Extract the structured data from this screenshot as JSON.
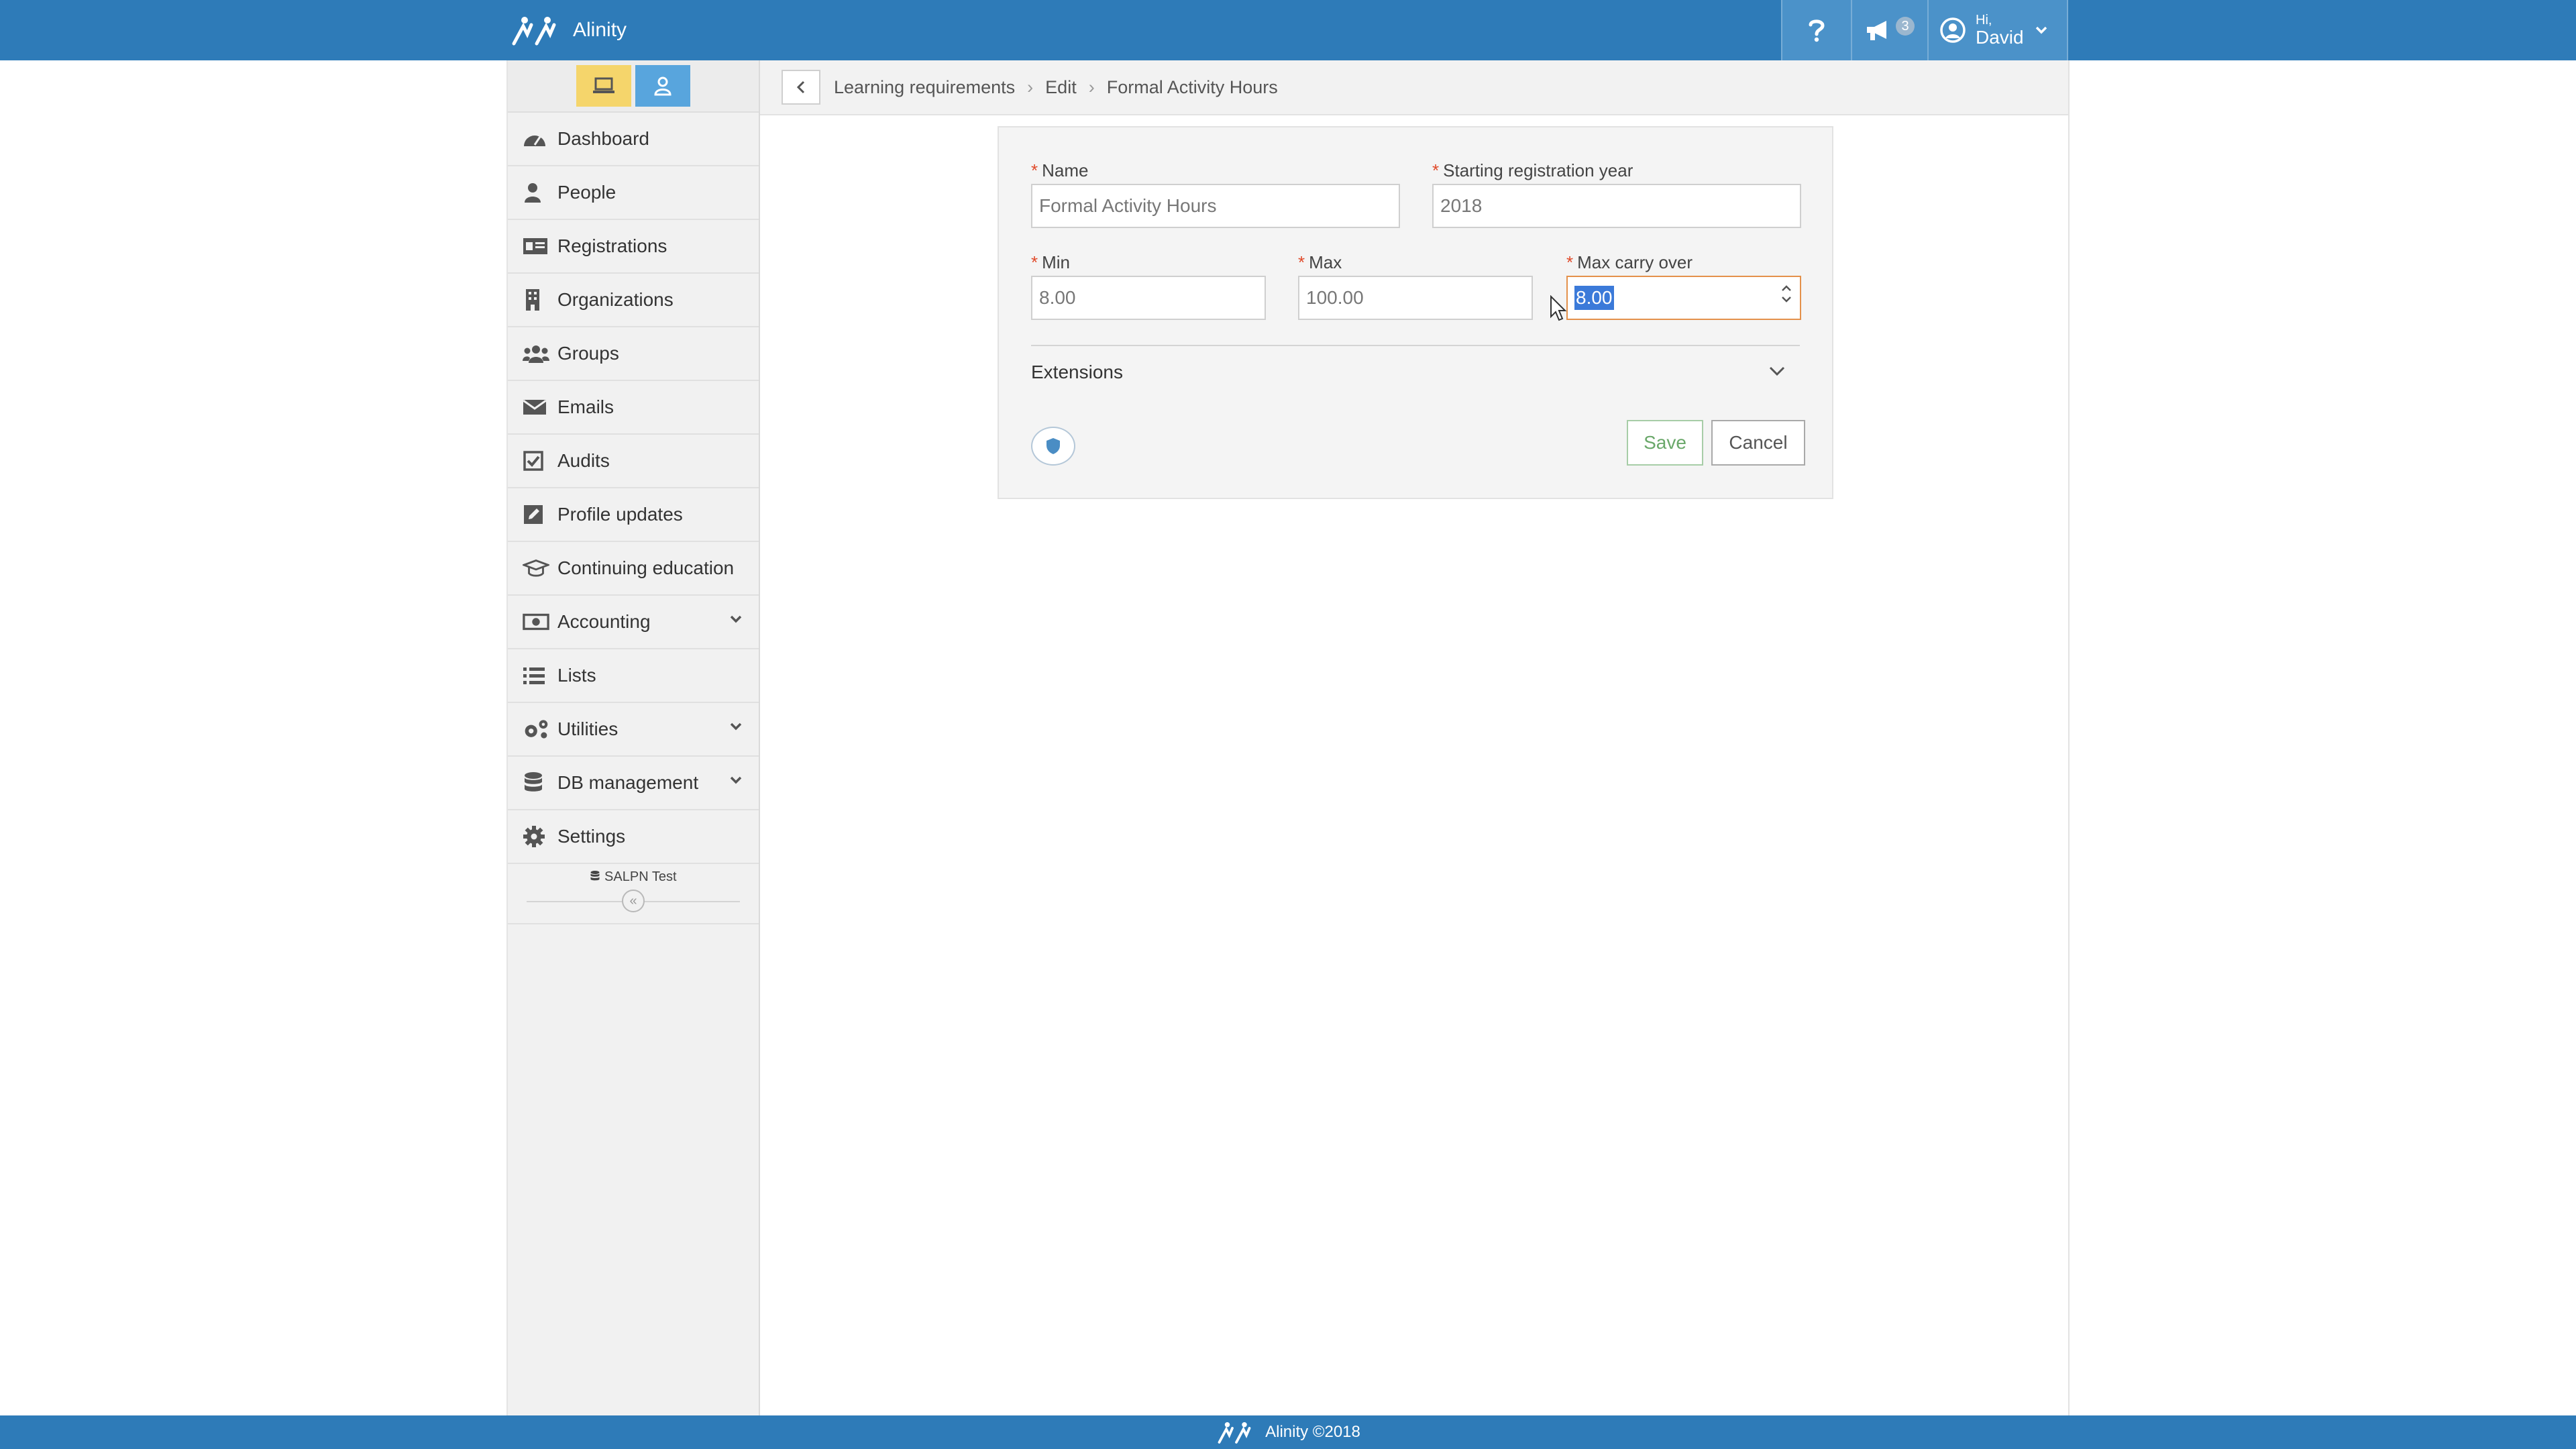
{
  "app": {
    "brand_name": "Alinity",
    "accent_color": "#2e7bb8"
  },
  "header": {
    "help_icon": "question-icon",
    "announcements": {
      "icon": "megaphone-icon",
      "count": "3"
    },
    "user": {
      "greeting": "Hi,",
      "name": "David",
      "icon": "user-circle-icon"
    }
  },
  "sidebar": {
    "toggles": [
      {
        "icon": "desktop-icon",
        "color": "#f5d56b"
      },
      {
        "icon": "person-icon",
        "color": "#58a5dd"
      }
    ],
    "items": [
      {
        "label": "Dashboard",
        "icon": "dashboard-icon"
      },
      {
        "label": "People",
        "icon": "person-icon"
      },
      {
        "label": "Registrations",
        "icon": "id-card-icon"
      },
      {
        "label": "Organizations",
        "icon": "building-icon"
      },
      {
        "label": "Groups",
        "icon": "group-icon"
      },
      {
        "label": "Emails",
        "icon": "envelope-icon"
      },
      {
        "label": "Audits",
        "icon": "checkbox-icon"
      },
      {
        "label": "Profile updates",
        "icon": "edit-icon"
      },
      {
        "label": "Continuing education",
        "icon": "graduation-cap-icon"
      },
      {
        "label": "Accounting",
        "icon": "money-icon",
        "expandable": true
      },
      {
        "label": "Lists",
        "icon": "list-icon"
      },
      {
        "label": "Utilities",
        "icon": "cogs-icon",
        "expandable": true
      },
      {
        "label": "DB management",
        "icon": "database-icon",
        "expandable": true
      },
      {
        "label": "Settings",
        "icon": "gear-icon"
      }
    ],
    "database_label": "SALPN Test",
    "collapse_symbol": "«"
  },
  "breadcrumb": {
    "items": [
      "Learning requirements",
      "Edit",
      "Formal Activity Hours"
    ],
    "separator": "›"
  },
  "form": {
    "name": {
      "label": "Name",
      "value": "Formal Activity Hours"
    },
    "start_year": {
      "label": "Starting registration year",
      "value": "2018"
    },
    "min": {
      "label": "Min",
      "value": "8.00"
    },
    "max": {
      "label": "Max",
      "value": "100.00"
    },
    "max_carry_over": {
      "label": "Max carry over",
      "value": "8.00"
    },
    "required_marker": "*",
    "extensions_label": "Extensions",
    "save_label": "Save",
    "cancel_label": "Cancel"
  },
  "footer": {
    "text": "Alinity ©2018"
  }
}
